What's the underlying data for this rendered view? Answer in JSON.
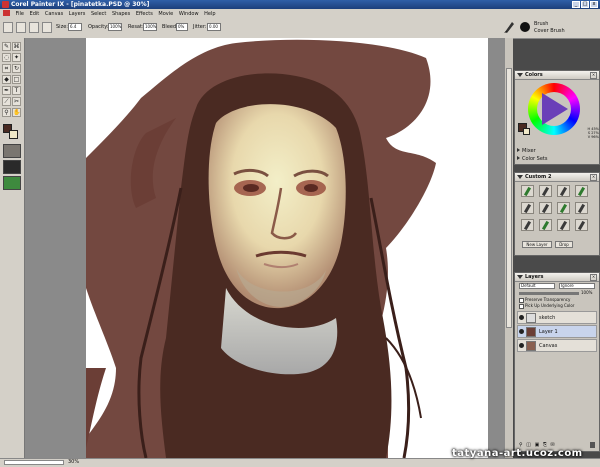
{
  "window": {
    "title": "Corel Painter IX - [pinatetka.PSD @ 30%]",
    "min": "_",
    "max": "□",
    "close": "x"
  },
  "menu": [
    "File",
    "Edit",
    "Canvas",
    "Layers",
    "Select",
    "Shapes",
    "Effects",
    "Movie",
    "Window",
    "Help"
  ],
  "property_bar": {
    "size_label": "Size:",
    "size_value": "6.4",
    "opacity_label": "Opacity:",
    "opacity_value": "100%",
    "resat_label": "Resat:",
    "resat_value": "100%",
    "bleed_label": "Bleed:",
    "bleed_value": "0%",
    "jitter_label": "Jitter:",
    "jitter_value": "0.00"
  },
  "brush_selector": {
    "category": "Brush",
    "variant": "Cover Brush"
  },
  "toolbox": {
    "tools": [
      {
        "name": "brush-tool",
        "glyph": "✎"
      },
      {
        "name": "dropper-tool",
        "glyph": "⌘"
      },
      {
        "name": "lasso-tool",
        "glyph": "◌"
      },
      {
        "name": "magic-wand-tool",
        "glyph": "✦"
      },
      {
        "name": "crop-tool",
        "glyph": "⌗"
      },
      {
        "name": "rotate-tool",
        "glyph": "↻"
      },
      {
        "name": "fill-tool",
        "glyph": "◆"
      },
      {
        "name": "rectangle-tool",
        "glyph": "□"
      },
      {
        "name": "pen-tool",
        "glyph": "✒"
      },
      {
        "name": "text-tool",
        "glyph": "T"
      },
      {
        "name": "eyedropper-tool",
        "glyph": "⟋"
      },
      {
        "name": "scissors-tool",
        "glyph": "✂"
      },
      {
        "name": "magnifier-tool",
        "glyph": "⚲"
      },
      {
        "name": "hand-tool",
        "glyph": "✋"
      }
    ]
  },
  "colors_panel": {
    "title": "Colors",
    "hsv_h": "H 45%",
    "hsv_s": "S 27%",
    "hsv_v": "V 96%",
    "sections": [
      {
        "label": "Mixer"
      },
      {
        "label": "Color Sets"
      }
    ]
  },
  "custom_palette": {
    "title": "Custom 2",
    "buttons": {
      "new_layer": "New Layer",
      "drop": "Drop"
    }
  },
  "layers_panel": {
    "title": "Layers",
    "composite_method": "Default",
    "composite_depth": "Ignore",
    "opacity": "100%",
    "option_preserve": "Preserve Transparency",
    "option_pick_up": "Pick Up Underlying Color",
    "layers": [
      {
        "name": "sketch"
      },
      {
        "name": "Layer 1"
      },
      {
        "name": "Canvas"
      }
    ],
    "footer_icons": "⚲ ◫ ▣ ⎘ ✉"
  },
  "status": {
    "zoom": "30%"
  },
  "watermark": "tatyana-art.ucoz.com",
  "colors": {
    "hair": "#4a2a22",
    "brown_wash": "#6b3e36",
    "skin_light": "#f1ecc4",
    "title_blue": "#2f5fa8"
  }
}
